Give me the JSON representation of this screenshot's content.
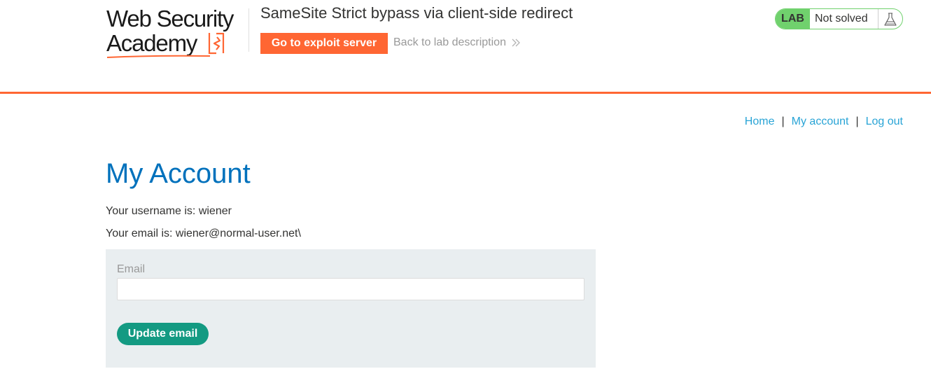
{
  "header": {
    "logo_line1": "Web Security",
    "logo_line2": "Academy",
    "lab_title": "SameSite Strict bypass via client-side redirect",
    "exploit_button": "Go to exploit server",
    "back_link": "Back to lab description",
    "status_badge": "LAB",
    "status_text": "Not solved",
    "status_icon": "flask-icon",
    "accent_color": "#ff6633",
    "status_color": "#70d16d"
  },
  "nav": {
    "home": "Home",
    "separator": "|",
    "my_account": "My account",
    "log_out": "Log out"
  },
  "main": {
    "title": "My Account",
    "username_line": "Your username is: wiener",
    "email_line": "Your email is: wiener@normal-user.net\\",
    "form": {
      "email_label": "Email",
      "email_value": "",
      "update_button": "Update email"
    }
  }
}
